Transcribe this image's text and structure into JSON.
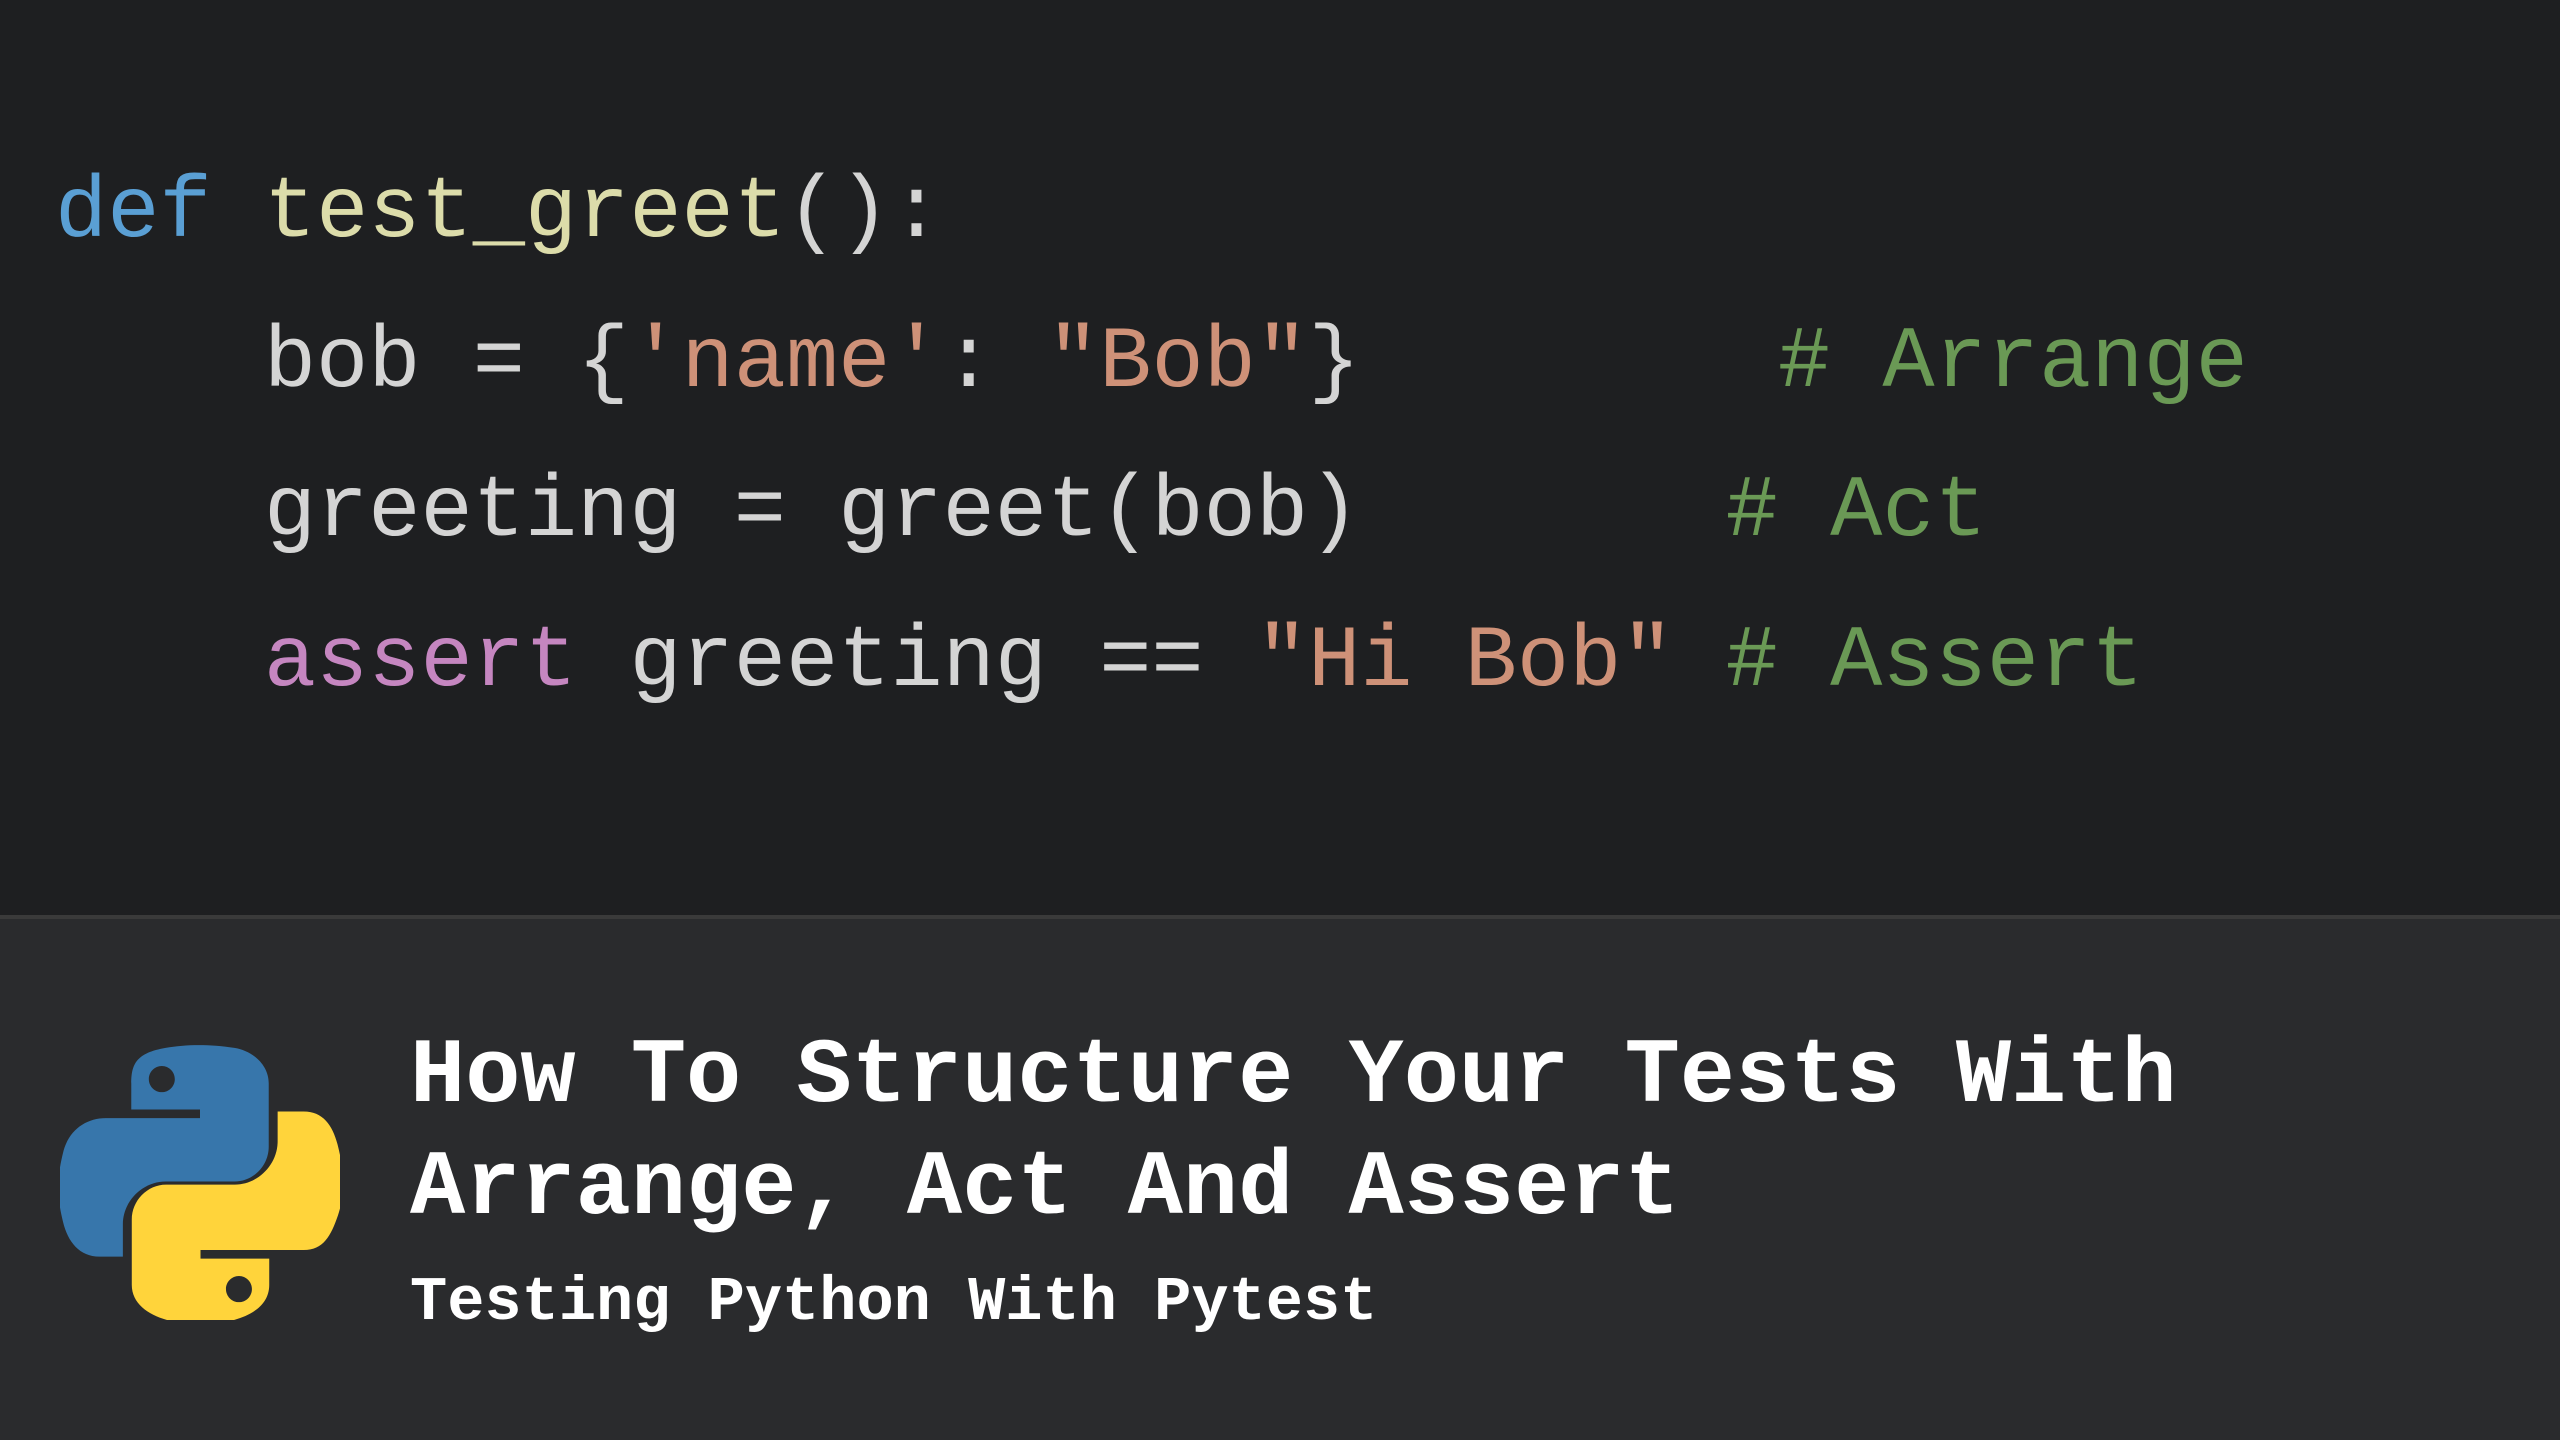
{
  "code": {
    "line1": {
      "def": "def",
      "fn": "test_greet",
      "rest": "():"
    },
    "line2": {
      "indent": "    ",
      "lhs": "bob ",
      "eq": "=",
      "sp1": " ",
      "lbrace": "{",
      "key": "'name'",
      "colon": ": ",
      "val": "\"Bob\"",
      "rbrace": "}",
      "pad": "        ",
      "comment": "# Arrange"
    },
    "line3": {
      "indent": "    ",
      "lhs": "greeting ",
      "eq": "=",
      "sp1": " ",
      "call": "greet",
      "paren": "(bob)",
      "pad": "       ",
      "comment": "# Act"
    },
    "line4": {
      "indent": "    ",
      "assert": "assert",
      "sp1": " ",
      "lhs": "greeting ",
      "eq": "==",
      "sp2": " ",
      "val": "\"Hi Bob\"",
      "pad": " ",
      "comment": "# Assert"
    }
  },
  "footer": {
    "title": "How To Structure Your Tests With Arrange, Act And Assert",
    "subtitle": "Testing Python With Pytest"
  }
}
